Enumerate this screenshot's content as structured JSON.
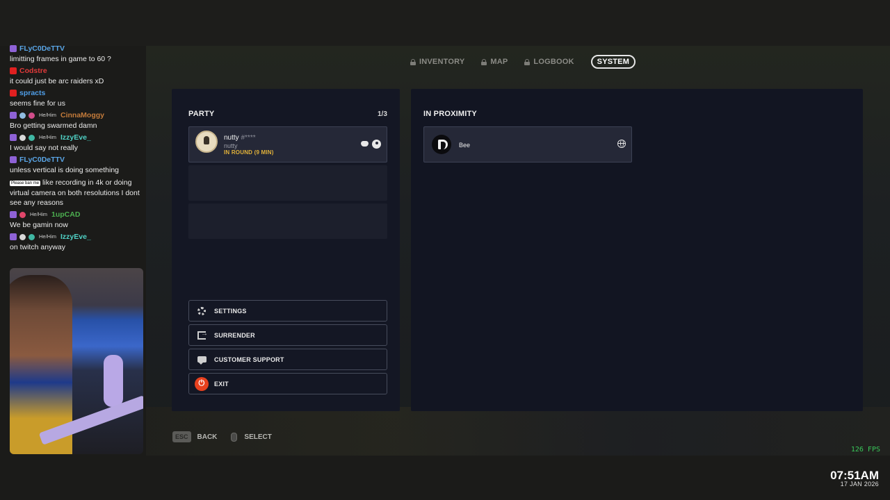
{
  "nav": {
    "tabs": [
      {
        "label": "INVENTORY",
        "locked": true
      },
      {
        "label": "MAP",
        "locked": true
      },
      {
        "label": "LOGBOOK",
        "locked": true
      },
      {
        "label": "SYSTEM",
        "active": true
      }
    ]
  },
  "party": {
    "title": "PARTY",
    "count": "1/3",
    "member": {
      "name": "nutty",
      "tag": "#****",
      "username": "nutty",
      "status": "IN ROUND (9 MIN)"
    }
  },
  "proximity": {
    "title": "IN PROXIMITY",
    "player": {
      "name": "Bee"
    }
  },
  "menu": {
    "settings": "SETTINGS",
    "surrender": "SURRENDER",
    "support": "CUSTOMER SUPPORT",
    "exit": "EXIT",
    "power_symbol": "⏻"
  },
  "footer": {
    "esc_key": "ESC",
    "back": "BACK",
    "select": "SELECT"
  },
  "chat": {
    "messages": [
      {
        "platform": "twitch",
        "user": "FLyC0DeTTV",
        "color": "#5aa5e6",
        "text": "limitting frames in game to 60 ?"
      },
      {
        "platform": "youtube",
        "user": "Codstre",
        "color": "#e23a3a",
        "text": "it could just be arc raiders xD"
      },
      {
        "platform": "youtube",
        "user": "spracts",
        "color": "#4f9ee8",
        "text": "seems fine for us"
      },
      {
        "platform": "twitch",
        "user": "CinnaMoggy",
        "color": "#c47b3a",
        "pronoun": "He/Him",
        "text": "Bro getting swarmed damn"
      },
      {
        "platform": "twitch",
        "user": "IzzyEve_",
        "color": "#4fd1c5",
        "pronoun": "He/Him",
        "text": "I would say not really"
      },
      {
        "platform": "twitch",
        "user": "FLyC0DeTTV",
        "color": "#5aa5e6",
        "text": "unless vertical is doing something"
      },
      {
        "badge": "Please ban me",
        "text": "like recording in 4k or doing virtual camera on both resolutions I dont see any reasons"
      },
      {
        "platform": "twitch",
        "user": "1upCAD",
        "color": "#4caf50",
        "pronoun": "He/Him",
        "text": "We be gamin now"
      },
      {
        "platform": "twitch",
        "user": "IzzyEve_",
        "color": "#4fd1c5",
        "pronoun": "He/Him",
        "text": "on twitch anyway"
      }
    ]
  },
  "overlay": {
    "fps": "126 FPS",
    "time": "07:51AM",
    "date": "17 JAN 2026"
  }
}
